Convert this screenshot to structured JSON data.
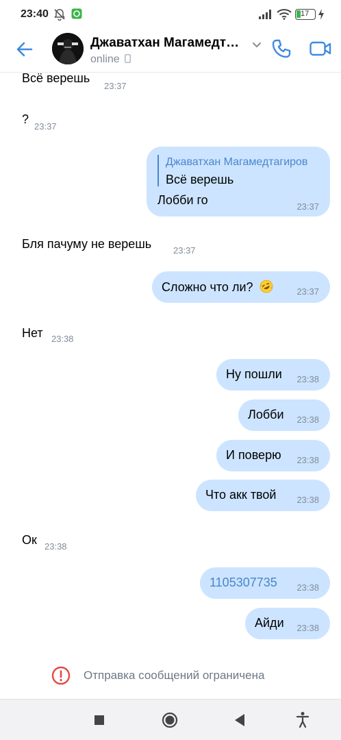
{
  "status_bar": {
    "time": "23:40",
    "battery": "17",
    "icons": [
      "bell-off-icon",
      "app-notification-icon",
      "signal-icon",
      "wifi-icon",
      "battery-icon",
      "charging-icon"
    ]
  },
  "header": {
    "name": "Джаватхан Магамедт…",
    "status": "online",
    "icons": [
      "back-arrow-icon",
      "chevron-down-icon",
      "phone-icon",
      "video-call-icon"
    ],
    "accent": "#3f8ae0"
  },
  "messages": [
    {
      "dir": "in",
      "text": "Всё верешь",
      "time": "23:37"
    },
    {
      "dir": "in",
      "text": "?",
      "time": "23:37"
    },
    {
      "dir": "out",
      "reply_to_name": "Джаватхан Магамедтагиров",
      "reply_to_text": "Всё верешь",
      "text": "Лобби го",
      "time": "23:37"
    },
    {
      "dir": "in",
      "text": "Бля пачуму не верешь",
      "time": "23:37"
    },
    {
      "dir": "out",
      "text": "Сложно что ли?",
      "emoji": "rofl-emoji",
      "time": "23:37"
    },
    {
      "dir": "in",
      "text": "Нет",
      "time": "23:38"
    },
    {
      "dir": "out",
      "text": "Ну пошли",
      "time": "23:38"
    },
    {
      "dir": "out",
      "text": "Лобби",
      "time": "23:38"
    },
    {
      "dir": "out",
      "text": "И поверю",
      "time": "23:38"
    },
    {
      "dir": "out",
      "text": "Что акк твой",
      "time": "23:38"
    },
    {
      "dir": "in",
      "text": "Ок",
      "time": "23:38"
    },
    {
      "dir": "out",
      "text": "1105307735",
      "is_link": true,
      "time": "23:38"
    },
    {
      "dir": "out",
      "text": "Айди",
      "time": "23:38"
    }
  ],
  "restriction": {
    "text": "Отправка сообщений ограничена",
    "icon": "warning-circle-icon",
    "icon_color": "#e64646"
  },
  "colors": {
    "bubble_out": "#cce4ff",
    "link": "#4986cc",
    "time": "#818c99"
  },
  "nav_bar": {
    "icons": [
      "recents-square-icon",
      "home-circle-icon",
      "back-triangle-icon",
      "accessibility-icon"
    ]
  }
}
